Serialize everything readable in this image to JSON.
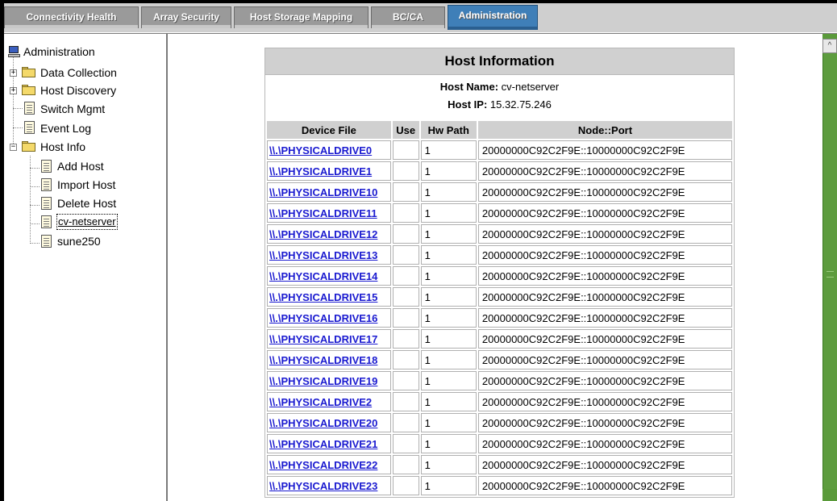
{
  "tabs": [
    {
      "label": "Connectivity Health",
      "active": false
    },
    {
      "label": "Array Security",
      "active": false
    },
    {
      "label": "Host Storage Mapping",
      "active": false
    },
    {
      "label": "BC/CA",
      "active": false
    },
    {
      "label": "Administration",
      "active": true
    }
  ],
  "tree": {
    "root": "Administration",
    "data_collection": "Data Collection",
    "host_discovery": "Host Discovery",
    "switch_mgmt": "Switch Mgmt",
    "event_log": "Event Log",
    "host_info": "Host Info",
    "add_host": "Add Host",
    "import_host": "Import Host",
    "delete_host": "Delete Host",
    "cv_netserver": "cv-netserver",
    "sune250": "sune250"
  },
  "host_panel": {
    "title": "Host Information",
    "host_name_label": "Host Name:",
    "host_name": "cv-netserver",
    "host_ip_label": "Host IP:",
    "host_ip": "15.32.75.246"
  },
  "columns": [
    "Device File",
    "Use",
    "Hw Path",
    "Node::Port"
  ],
  "rows": [
    {
      "device": "\\\\.\\PHYSICALDRIVE0",
      "use": "",
      "hw_path": "1",
      "node_port": "20000000C92C2F9E::10000000C92C2F9E"
    },
    {
      "device": "\\\\.\\PHYSICALDRIVE1",
      "use": "",
      "hw_path": "1",
      "node_port": "20000000C92C2F9E::10000000C92C2F9E"
    },
    {
      "device": "\\\\.\\PHYSICALDRIVE10",
      "use": "",
      "hw_path": "1",
      "node_port": "20000000C92C2F9E::10000000C92C2F9E"
    },
    {
      "device": "\\\\.\\PHYSICALDRIVE11",
      "use": "",
      "hw_path": "1",
      "node_port": "20000000C92C2F9E::10000000C92C2F9E"
    },
    {
      "device": "\\\\.\\PHYSICALDRIVE12",
      "use": "",
      "hw_path": "1",
      "node_port": "20000000C92C2F9E::10000000C92C2F9E"
    },
    {
      "device": "\\\\.\\PHYSICALDRIVE13",
      "use": "",
      "hw_path": "1",
      "node_port": "20000000C92C2F9E::10000000C92C2F9E"
    },
    {
      "device": "\\\\.\\PHYSICALDRIVE14",
      "use": "",
      "hw_path": "1",
      "node_port": "20000000C92C2F9E::10000000C92C2F9E"
    },
    {
      "device": "\\\\.\\PHYSICALDRIVE15",
      "use": "",
      "hw_path": "1",
      "node_port": "20000000C92C2F9E::10000000C92C2F9E"
    },
    {
      "device": "\\\\.\\PHYSICALDRIVE16",
      "use": "",
      "hw_path": "1",
      "node_port": "20000000C92C2F9E::10000000C92C2F9E"
    },
    {
      "device": "\\\\.\\PHYSICALDRIVE17",
      "use": "",
      "hw_path": "1",
      "node_port": "20000000C92C2F9E::10000000C92C2F9E"
    },
    {
      "device": "\\\\.\\PHYSICALDRIVE18",
      "use": "",
      "hw_path": "1",
      "node_port": "20000000C92C2F9E::10000000C92C2F9E"
    },
    {
      "device": "\\\\.\\PHYSICALDRIVE19",
      "use": "",
      "hw_path": "1",
      "node_port": "20000000C92C2F9E::10000000C92C2F9E"
    },
    {
      "device": "\\\\.\\PHYSICALDRIVE2",
      "use": "",
      "hw_path": "1",
      "node_port": "20000000C92C2F9E::10000000C92C2F9E"
    },
    {
      "device": "\\\\.\\PHYSICALDRIVE20",
      "use": "",
      "hw_path": "1",
      "node_port": "20000000C92C2F9E::10000000C92C2F9E"
    },
    {
      "device": "\\\\.\\PHYSICALDRIVE21",
      "use": "",
      "hw_path": "1",
      "node_port": "20000000C92C2F9E::10000000C92C2F9E"
    },
    {
      "device": "\\\\.\\PHYSICALDRIVE22",
      "use": "",
      "hw_path": "1",
      "node_port": "20000000C92C2F9E::10000000C92C2F9E"
    },
    {
      "device": "\\\\.\\PHYSICALDRIVE23",
      "use": "",
      "hw_path": "1",
      "node_port": "20000000C92C2F9E::10000000C92C2F9E"
    }
  ],
  "scroll_up_glyph": "^",
  "colors": {
    "active_tab": "#3f7fb8",
    "inactive_tab": "#9a9a9a",
    "scrollbar": "#5d9c3e",
    "link": "#1a1ad0"
  }
}
